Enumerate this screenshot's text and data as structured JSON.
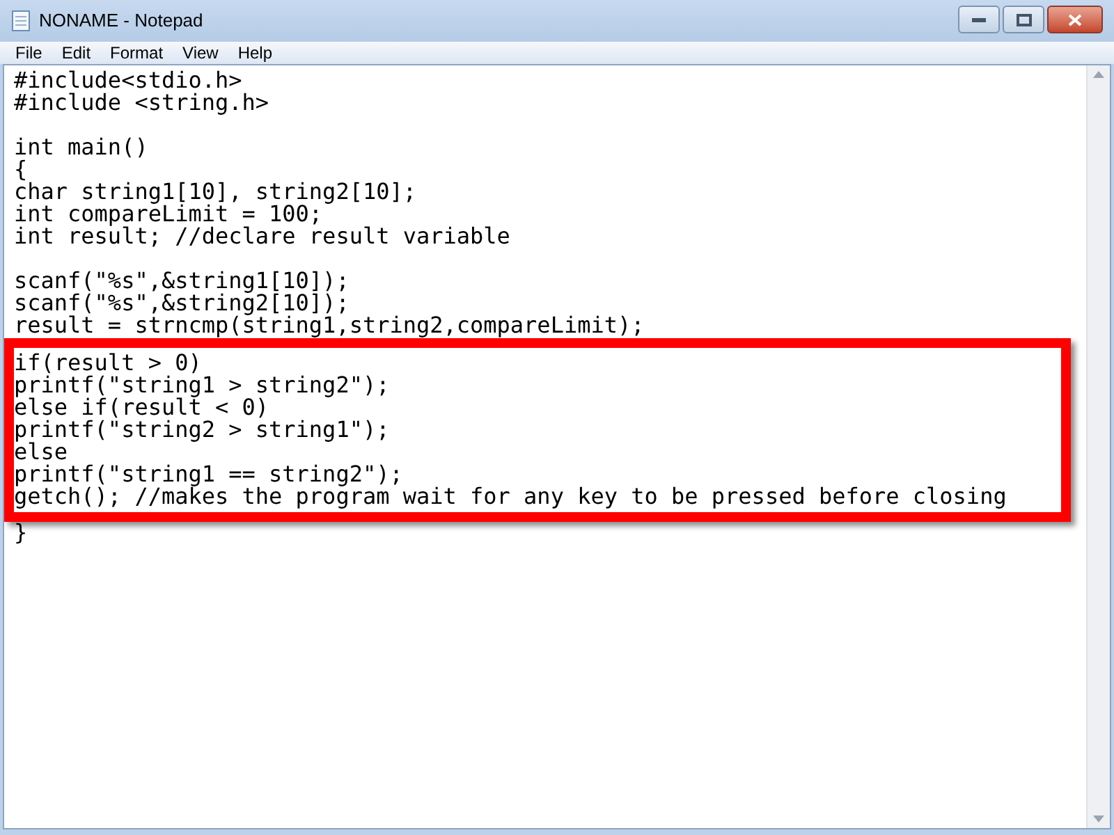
{
  "window": {
    "title": "NONAME - Notepad"
  },
  "menu": [
    "File",
    "Edit",
    "Format",
    "View",
    "Help"
  ],
  "editor": {
    "lines_before": [
      {
        "kind": "code",
        "text": "#include<stdio.h>"
      },
      {
        "kind": "code",
        "text": "#include <string.h>"
      },
      {
        "kind": "blank"
      },
      {
        "kind": "code",
        "text": "int main()"
      },
      {
        "kind": "code",
        "text": "{"
      },
      {
        "kind": "code",
        "text": "char string1[10], string2[10];"
      },
      {
        "kind": "code",
        "text": "int compareLimit = 100;"
      },
      {
        "kind": "code",
        "text": "int result; //declare result variable"
      },
      {
        "kind": "blank"
      },
      {
        "kind": "code",
        "text": "scanf(\"%s\",&string1[10]);"
      },
      {
        "kind": "code",
        "text": "scanf(\"%s\",&string2[10]);"
      },
      {
        "kind": "code",
        "text": "result = strncmp(string1,string2,compareLimit);"
      }
    ],
    "highlighted_lines": [
      {
        "kind": "code",
        "text": "if(result > 0)"
      },
      {
        "kind": "code",
        "text": "printf(\"string1 > string2\");"
      },
      {
        "kind": "code",
        "text": "else if(result < 0)"
      },
      {
        "kind": "code",
        "text": "printf(\"string2 > string1\");"
      },
      {
        "kind": "code",
        "text": "else"
      },
      {
        "kind": "code",
        "text": "printf(\"string1 == string2\");"
      },
      {
        "kind": "code",
        "text": "getch(); //makes the program wait for any key to be pressed before closing"
      }
    ],
    "lines_after": [
      {
        "kind": "code",
        "text": "}"
      }
    ]
  }
}
